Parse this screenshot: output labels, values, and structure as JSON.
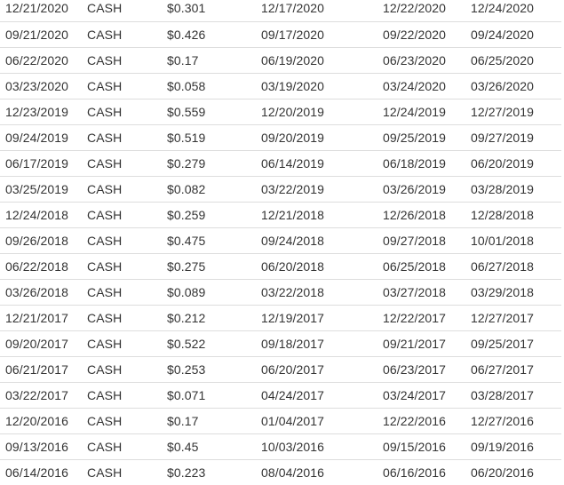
{
  "dividends": {
    "rows": [
      {
        "ex_date": "12/21/2020",
        "type": "CASH",
        "amount": "$0.301",
        "declaration_date": "12/17/2020",
        "record_date": "12/22/2020",
        "payment_date": "12/24/2020"
      },
      {
        "ex_date": "09/21/2020",
        "type": "CASH",
        "amount": "$0.426",
        "declaration_date": "09/17/2020",
        "record_date": "09/22/2020",
        "payment_date": "09/24/2020"
      },
      {
        "ex_date": "06/22/2020",
        "type": "CASH",
        "amount": "$0.17",
        "declaration_date": "06/19/2020",
        "record_date": "06/23/2020",
        "payment_date": "06/25/2020"
      },
      {
        "ex_date": "03/23/2020",
        "type": "CASH",
        "amount": "$0.058",
        "declaration_date": "03/19/2020",
        "record_date": "03/24/2020",
        "payment_date": "03/26/2020"
      },
      {
        "ex_date": "12/23/2019",
        "type": "CASH",
        "amount": "$0.559",
        "declaration_date": "12/20/2019",
        "record_date": "12/24/2019",
        "payment_date": "12/27/2019"
      },
      {
        "ex_date": "09/24/2019",
        "type": "CASH",
        "amount": "$0.519",
        "declaration_date": "09/20/2019",
        "record_date": "09/25/2019",
        "payment_date": "09/27/2019"
      },
      {
        "ex_date": "06/17/2019",
        "type": "CASH",
        "amount": "$0.279",
        "declaration_date": "06/14/2019",
        "record_date": "06/18/2019",
        "payment_date": "06/20/2019"
      },
      {
        "ex_date": "03/25/2019",
        "type": "CASH",
        "amount": "$0.082",
        "declaration_date": "03/22/2019",
        "record_date": "03/26/2019",
        "payment_date": "03/28/2019"
      },
      {
        "ex_date": "12/24/2018",
        "type": "CASH",
        "amount": "$0.259",
        "declaration_date": "12/21/2018",
        "record_date": "12/26/2018",
        "payment_date": "12/28/2018"
      },
      {
        "ex_date": "09/26/2018",
        "type": "CASH",
        "amount": "$0.475",
        "declaration_date": "09/24/2018",
        "record_date": "09/27/2018",
        "payment_date": "10/01/2018"
      },
      {
        "ex_date": "06/22/2018",
        "type": "CASH",
        "amount": "$0.275",
        "declaration_date": "06/20/2018",
        "record_date": "06/25/2018",
        "payment_date": "06/27/2018"
      },
      {
        "ex_date": "03/26/2018",
        "type": "CASH",
        "amount": "$0.089",
        "declaration_date": "03/22/2018",
        "record_date": "03/27/2018",
        "payment_date": "03/29/2018"
      },
      {
        "ex_date": "12/21/2017",
        "type": "CASH",
        "amount": "$0.212",
        "declaration_date": "12/19/2017",
        "record_date": "12/22/2017",
        "payment_date": "12/27/2017"
      },
      {
        "ex_date": "09/20/2017",
        "type": "CASH",
        "amount": "$0.522",
        "declaration_date": "09/18/2017",
        "record_date": "09/21/2017",
        "payment_date": "09/25/2017"
      },
      {
        "ex_date": "06/21/2017",
        "type": "CASH",
        "amount": "$0.253",
        "declaration_date": "06/20/2017",
        "record_date": "06/23/2017",
        "payment_date": "06/27/2017"
      },
      {
        "ex_date": "03/22/2017",
        "type": "CASH",
        "amount": "$0.071",
        "declaration_date": "04/24/2017",
        "record_date": "03/24/2017",
        "payment_date": "03/28/2017"
      },
      {
        "ex_date": "12/20/2016",
        "type": "CASH",
        "amount": "$0.17",
        "declaration_date": "01/04/2017",
        "record_date": "12/22/2016",
        "payment_date": "12/27/2016"
      },
      {
        "ex_date": "09/13/2016",
        "type": "CASH",
        "amount": "$0.45",
        "declaration_date": "10/03/2016",
        "record_date": "09/15/2016",
        "payment_date": "09/19/2016"
      },
      {
        "ex_date": "06/14/2016",
        "type": "CASH",
        "amount": "$0.223",
        "declaration_date": "08/04/2016",
        "record_date": "06/16/2016",
        "payment_date": "06/20/2016"
      }
    ]
  }
}
